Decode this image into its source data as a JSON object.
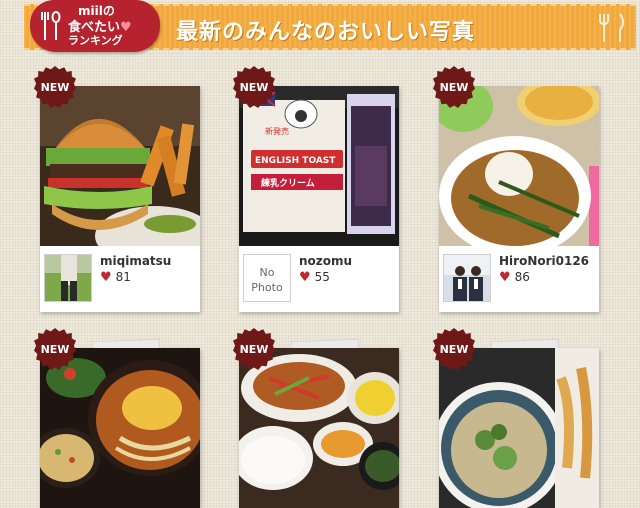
{
  "header": {
    "logo_line1": "miilの",
    "logo_line2": "食べたい",
    "logo_heart": "♥",
    "logo_line3": "ランキング",
    "title": "最新のみんなのおいしい写真"
  },
  "badge": "NEW",
  "cards": [
    {
      "user": "miqimatsu",
      "likes": "81",
      "avatar": "photo"
    },
    {
      "user": "nozomu",
      "likes": "55",
      "avatar": "none",
      "avatar_text1": "No",
      "avatar_text2": "Photo"
    },
    {
      "user": "HiroNori0126",
      "likes": "86",
      "avatar": "photo"
    },
    {
      "user": "",
      "likes": ""
    },
    {
      "user": "",
      "likes": ""
    },
    {
      "user": "",
      "likes": ""
    }
  ],
  "photo_labels": {
    "bread_brand": "ENGLISH TOAST",
    "bread_sub": "練乳クリーム",
    "bread_new": "新発売"
  },
  "colors": {
    "accent": "#b6232f",
    "banner": "#f2a93b",
    "heart": "#c0282f"
  }
}
